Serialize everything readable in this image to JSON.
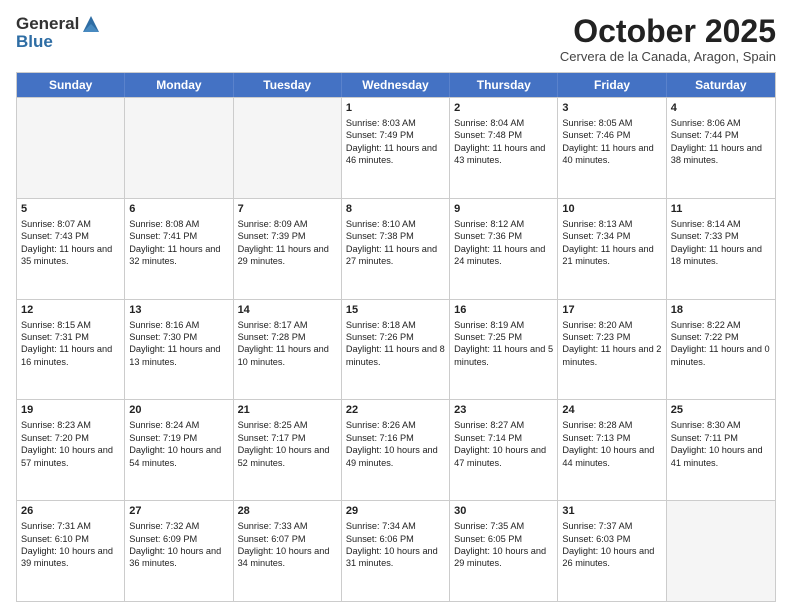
{
  "header": {
    "logo_line1": "General",
    "logo_line2": "Blue",
    "title": "October 2025",
    "subtitle": "Cervera de la Canada, Aragon, Spain"
  },
  "days_of_week": [
    "Sunday",
    "Monday",
    "Tuesday",
    "Wednesday",
    "Thursday",
    "Friday",
    "Saturday"
  ],
  "weeks": [
    [
      {
        "day": "",
        "sunrise": "",
        "sunset": "",
        "daylight": "",
        "empty": true
      },
      {
        "day": "",
        "sunrise": "",
        "sunset": "",
        "daylight": "",
        "empty": true
      },
      {
        "day": "",
        "sunrise": "",
        "sunset": "",
        "daylight": "",
        "empty": true
      },
      {
        "day": "1",
        "sunrise": "Sunrise: 8:03 AM",
        "sunset": "Sunset: 7:49 PM",
        "daylight": "Daylight: 11 hours and 46 minutes."
      },
      {
        "day": "2",
        "sunrise": "Sunrise: 8:04 AM",
        "sunset": "Sunset: 7:48 PM",
        "daylight": "Daylight: 11 hours and 43 minutes."
      },
      {
        "day": "3",
        "sunrise": "Sunrise: 8:05 AM",
        "sunset": "Sunset: 7:46 PM",
        "daylight": "Daylight: 11 hours and 40 minutes."
      },
      {
        "day": "4",
        "sunrise": "Sunrise: 8:06 AM",
        "sunset": "Sunset: 7:44 PM",
        "daylight": "Daylight: 11 hours and 38 minutes."
      }
    ],
    [
      {
        "day": "5",
        "sunrise": "Sunrise: 8:07 AM",
        "sunset": "Sunset: 7:43 PM",
        "daylight": "Daylight: 11 hours and 35 minutes."
      },
      {
        "day": "6",
        "sunrise": "Sunrise: 8:08 AM",
        "sunset": "Sunset: 7:41 PM",
        "daylight": "Daylight: 11 hours and 32 minutes."
      },
      {
        "day": "7",
        "sunrise": "Sunrise: 8:09 AM",
        "sunset": "Sunset: 7:39 PM",
        "daylight": "Daylight: 11 hours and 29 minutes."
      },
      {
        "day": "8",
        "sunrise": "Sunrise: 8:10 AM",
        "sunset": "Sunset: 7:38 PM",
        "daylight": "Daylight: 11 hours and 27 minutes."
      },
      {
        "day": "9",
        "sunrise": "Sunrise: 8:12 AM",
        "sunset": "Sunset: 7:36 PM",
        "daylight": "Daylight: 11 hours and 24 minutes."
      },
      {
        "day": "10",
        "sunrise": "Sunrise: 8:13 AM",
        "sunset": "Sunset: 7:34 PM",
        "daylight": "Daylight: 11 hours and 21 minutes."
      },
      {
        "day": "11",
        "sunrise": "Sunrise: 8:14 AM",
        "sunset": "Sunset: 7:33 PM",
        "daylight": "Daylight: 11 hours and 18 minutes."
      }
    ],
    [
      {
        "day": "12",
        "sunrise": "Sunrise: 8:15 AM",
        "sunset": "Sunset: 7:31 PM",
        "daylight": "Daylight: 11 hours and 16 minutes."
      },
      {
        "day": "13",
        "sunrise": "Sunrise: 8:16 AM",
        "sunset": "Sunset: 7:30 PM",
        "daylight": "Daylight: 11 hours and 13 minutes."
      },
      {
        "day": "14",
        "sunrise": "Sunrise: 8:17 AM",
        "sunset": "Sunset: 7:28 PM",
        "daylight": "Daylight: 11 hours and 10 minutes."
      },
      {
        "day": "15",
        "sunrise": "Sunrise: 8:18 AM",
        "sunset": "Sunset: 7:26 PM",
        "daylight": "Daylight: 11 hours and 8 minutes."
      },
      {
        "day": "16",
        "sunrise": "Sunrise: 8:19 AM",
        "sunset": "Sunset: 7:25 PM",
        "daylight": "Daylight: 11 hours and 5 minutes."
      },
      {
        "day": "17",
        "sunrise": "Sunrise: 8:20 AM",
        "sunset": "Sunset: 7:23 PM",
        "daylight": "Daylight: 11 hours and 2 minutes."
      },
      {
        "day": "18",
        "sunrise": "Sunrise: 8:22 AM",
        "sunset": "Sunset: 7:22 PM",
        "daylight": "Daylight: 11 hours and 0 minutes."
      }
    ],
    [
      {
        "day": "19",
        "sunrise": "Sunrise: 8:23 AM",
        "sunset": "Sunset: 7:20 PM",
        "daylight": "Daylight: 10 hours and 57 minutes."
      },
      {
        "day": "20",
        "sunrise": "Sunrise: 8:24 AM",
        "sunset": "Sunset: 7:19 PM",
        "daylight": "Daylight: 10 hours and 54 minutes."
      },
      {
        "day": "21",
        "sunrise": "Sunrise: 8:25 AM",
        "sunset": "Sunset: 7:17 PM",
        "daylight": "Daylight: 10 hours and 52 minutes."
      },
      {
        "day": "22",
        "sunrise": "Sunrise: 8:26 AM",
        "sunset": "Sunset: 7:16 PM",
        "daylight": "Daylight: 10 hours and 49 minutes."
      },
      {
        "day": "23",
        "sunrise": "Sunrise: 8:27 AM",
        "sunset": "Sunset: 7:14 PM",
        "daylight": "Daylight: 10 hours and 47 minutes."
      },
      {
        "day": "24",
        "sunrise": "Sunrise: 8:28 AM",
        "sunset": "Sunset: 7:13 PM",
        "daylight": "Daylight: 10 hours and 44 minutes."
      },
      {
        "day": "25",
        "sunrise": "Sunrise: 8:30 AM",
        "sunset": "Sunset: 7:11 PM",
        "daylight": "Daylight: 10 hours and 41 minutes."
      }
    ],
    [
      {
        "day": "26",
        "sunrise": "Sunrise: 7:31 AM",
        "sunset": "Sunset: 6:10 PM",
        "daylight": "Daylight: 10 hours and 39 minutes."
      },
      {
        "day": "27",
        "sunrise": "Sunrise: 7:32 AM",
        "sunset": "Sunset: 6:09 PM",
        "daylight": "Daylight: 10 hours and 36 minutes."
      },
      {
        "day": "28",
        "sunrise": "Sunrise: 7:33 AM",
        "sunset": "Sunset: 6:07 PM",
        "daylight": "Daylight: 10 hours and 34 minutes."
      },
      {
        "day": "29",
        "sunrise": "Sunrise: 7:34 AM",
        "sunset": "Sunset: 6:06 PM",
        "daylight": "Daylight: 10 hours and 31 minutes."
      },
      {
        "day": "30",
        "sunrise": "Sunrise: 7:35 AM",
        "sunset": "Sunset: 6:05 PM",
        "daylight": "Daylight: 10 hours and 29 minutes."
      },
      {
        "day": "31",
        "sunrise": "Sunrise: 7:37 AM",
        "sunset": "Sunset: 6:03 PM",
        "daylight": "Daylight: 10 hours and 26 minutes."
      },
      {
        "day": "",
        "sunrise": "",
        "sunset": "",
        "daylight": "",
        "empty": true
      }
    ]
  ]
}
